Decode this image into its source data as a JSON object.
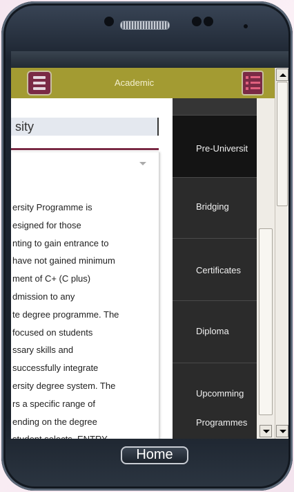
{
  "header": {
    "title": "Academic",
    "menu_button": "hamburger-icon",
    "list_button": "list-icon"
  },
  "content": {
    "title": "sity",
    "body_lines": [
      "ersity Programme is",
      "esigned for those",
      "nting to gain entrance to",
      "have not gained minimum",
      "ment of C+ (C plus)",
      "dmission to any",
      "te degree programme. The",
      "focused on students",
      "ssary skills and",
      "successfully integrate",
      "ersity degree system. The",
      "rs a specific range of",
      "ending on the degree",
      "student selects. ENTRY"
    ]
  },
  "sidebar": {
    "items": [
      {
        "label": "Pre-Universit"
      },
      {
        "label": "Bridging"
      },
      {
        "label": "Certificates"
      },
      {
        "label": "Diploma"
      },
      {
        "label": "Upcomming"
      },
      {
        "label": "Programmes"
      }
    ]
  },
  "device": {
    "home_label": "Home"
  },
  "colors": {
    "header": "#a39b32",
    "accent": "#7a2a45",
    "sidebar": "#2b2b2b"
  }
}
